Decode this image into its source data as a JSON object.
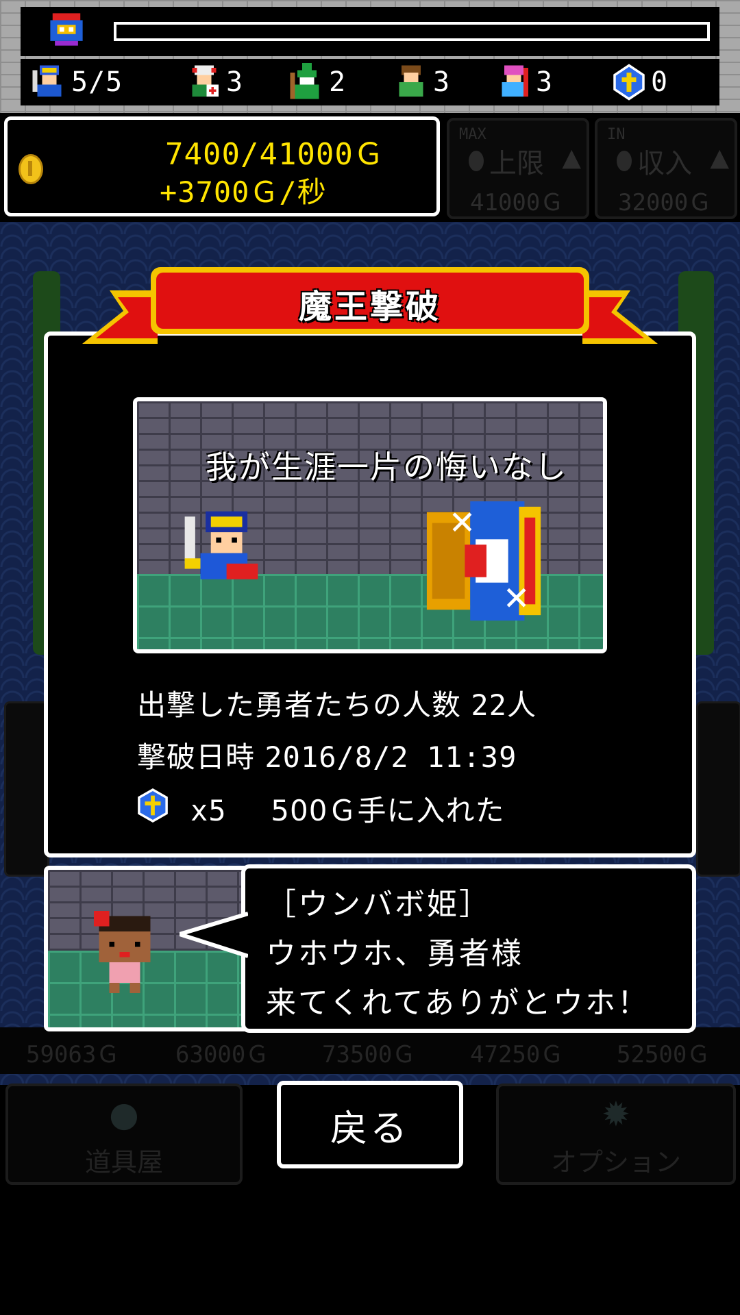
{
  "top": {
    "unit_counts": [
      {
        "name": "hero-unit-icon",
        "count": "5/5"
      },
      {
        "name": "warrior-unit-icon",
        "count": "3"
      },
      {
        "name": "wizard-unit-icon",
        "count": "2"
      },
      {
        "name": "villager-unit-icon",
        "count": "3"
      },
      {
        "name": "cleric-unit-icon",
        "count": "3"
      },
      {
        "name": "gem-unit-icon",
        "count": "0"
      }
    ]
  },
  "gold": {
    "current": "7400/41000Ｇ",
    "rate": "+3700Ｇ/秒"
  },
  "upgrades": {
    "max": {
      "tag": "MAX",
      "label": "上限",
      "value": "41000Ｇ"
    },
    "income": {
      "tag": "IN",
      "label": "収入",
      "value": "32000Ｇ"
    }
  },
  "dim_prices": [
    "59063Ｇ",
    "63000Ｇ",
    "73500Ｇ",
    "47250Ｇ",
    "52500Ｇ"
  ],
  "modal": {
    "title": "魔王撃破",
    "scene_text": "我が生涯一片の悔いなし",
    "heroes_label": "出撃した勇者たちの人数",
    "heroes_value": "22人",
    "date_label": "撃破日時",
    "date_value": "2016/8/2 11:39",
    "reward_gems": "x5",
    "reward_gold": "500Ｇ手に入れた"
  },
  "dialog": {
    "speaker": "［ウンバボ姫］",
    "line1": "ウホウホ、勇者様",
    "line2": "来てくれてありがとウホ！"
  },
  "bottom": {
    "shop_label": "道具屋",
    "back_label": "戻る",
    "options_label": "オプション"
  },
  "colors": {
    "gold_text": "#ffe400",
    "ribbon_red": "#e01010",
    "ribbon_gold": "#f5c400",
    "floor_green": "#2e8061"
  }
}
